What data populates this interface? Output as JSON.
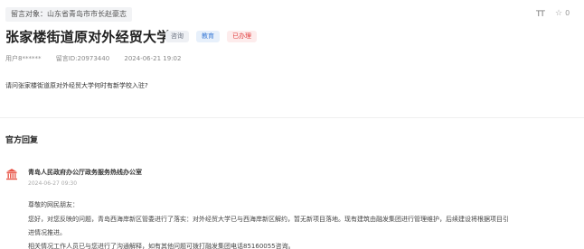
{
  "header": {
    "recipient": "留言对象：山东省青岛市市长赵豪志",
    "font_toggle": "TT",
    "follow_icon": "star-outline-icon",
    "follow_count": "0"
  },
  "message": {
    "title": "张家楼街道原对外经贸大学",
    "tags": [
      {
        "label": "咨询",
        "color": "#6b7280"
      },
      {
        "label": "教育",
        "color": "#3b7bd6"
      },
      {
        "label": "已办理",
        "color": "#e03b3b"
      }
    ],
    "user": "用户8******",
    "message_id": "留言ID:20973440",
    "datetime": "2024-06-21 19:02",
    "content": "请问张家楼街道原对外经贸大学何时有新学校入驻?"
  },
  "official_reply": {
    "heading": "官方回复",
    "org_icon": "government-building-icon",
    "org_name": "青岛人民政府办公厅政务服务热线办公室",
    "date": "2024-06-27 09:30",
    "lines": [
      "尊敬的网民朋友：",
      "您好，对您反映的问题，青岛西海岸新区管委进行了落实：对外经贸大学已与西海岸新区解约，暂无新项目落地。现有建筑由融发集团进行管理维护，后续建设将根据项目引",
      "进情况推进。",
      "相关情况工作人员已与您进行了沟通解释，如有其他问题可拨打融发集团电话85160055咨询。"
    ]
  }
}
